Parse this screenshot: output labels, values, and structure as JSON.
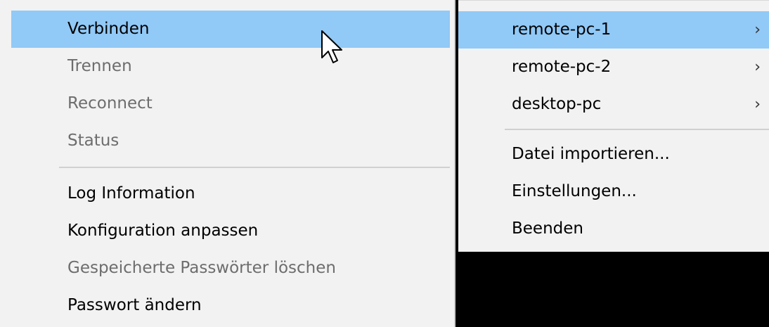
{
  "main_menu": {
    "items": [
      {
        "label": "Verbinden",
        "state": "highlighted"
      },
      {
        "label": "Trennen",
        "state": "disabled"
      },
      {
        "label": "Reconnect",
        "state": "disabled"
      },
      {
        "label": "Status",
        "state": "disabled"
      },
      {
        "label": "Log Information",
        "state": "enabled"
      },
      {
        "label": "Konfiguration anpassen",
        "state": "enabled"
      },
      {
        "label": "Gespeicherte Passwörter löschen",
        "state": "disabled"
      },
      {
        "label": "Passwort ändern",
        "state": "enabled"
      }
    ]
  },
  "sub_menu": {
    "items": [
      {
        "label": "remote-pc-1",
        "chevron": "›",
        "state": "highlighted"
      },
      {
        "label": "remote-pc-2",
        "chevron": "›",
        "state": "enabled"
      },
      {
        "label": "desktop-pc",
        "chevron": "›",
        "state": "enabled"
      },
      {
        "label": "Datei importieren...",
        "state": "enabled"
      },
      {
        "label": "Einstellungen...",
        "state": "enabled"
      },
      {
        "label": "Beenden",
        "state": "enabled"
      }
    ]
  },
  "colors": {
    "highlight": "#91c9f7",
    "menu_bg": "#f2f2f2",
    "disabled_text": "#6d6d6d",
    "separator": "#d0d0d0",
    "backdrop": "#000000"
  },
  "icons": {
    "cursor": "mouse-pointer-icon",
    "submenu_arrow": "chevron-right-icon"
  }
}
